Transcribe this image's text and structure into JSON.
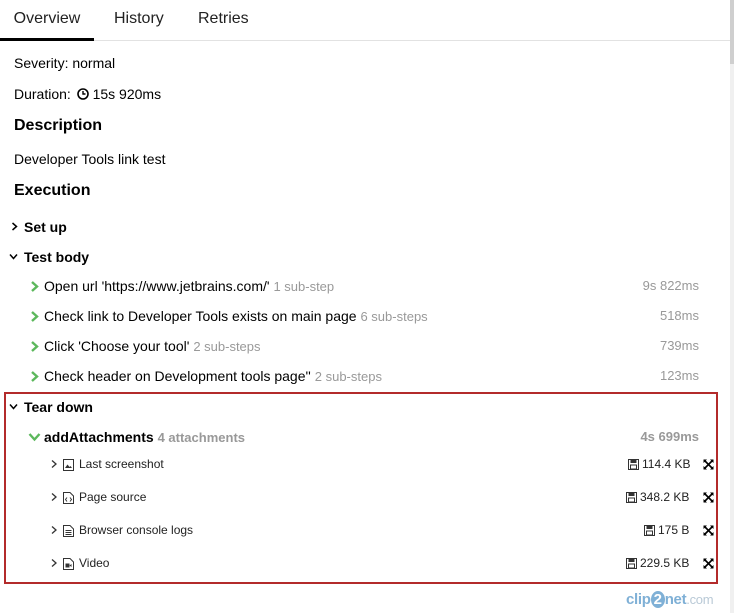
{
  "tabs": [
    "Overview",
    "History",
    "Retries"
  ],
  "severity": "Severity: normal",
  "duration_label": "Duration:",
  "duration_value": "15s 920ms",
  "description_heading": "Description",
  "description_text": "Developer Tools link test",
  "execution_heading": "Execution",
  "setup_label": "Set up",
  "test_body_label": "Test body",
  "steps": [
    {
      "name": "Open url 'https://www.jetbrains.com/'",
      "sub": "1 sub-step",
      "time": "9s 822ms"
    },
    {
      "name": "Check link to Developer Tools exists on main page",
      "sub": "6 sub-steps",
      "time": "518ms"
    },
    {
      "name": "Click 'Choose your tool'",
      "sub": "2 sub-steps",
      "time": "739ms"
    },
    {
      "name": "Check header on Development tools page''",
      "sub": "2 sub-steps",
      "time": "123ms"
    }
  ],
  "teardown_label": "Tear down",
  "add_attachments": {
    "name": "addAttachments",
    "count": "4 attachments",
    "time": "4s 699ms"
  },
  "attachments": [
    {
      "name": "Last screenshot",
      "size": "114.4 KB",
      "icon": "image-file-icon"
    },
    {
      "name": "Page source",
      "size": "348.2 KB",
      "icon": "code-file-icon"
    },
    {
      "name": "Browser console logs",
      "size": "175 B",
      "icon": "text-file-icon"
    },
    {
      "name": "Video",
      "size": "229.5 KB",
      "icon": "video-file-icon"
    }
  ],
  "watermark": {
    "a": "clip",
    "b": "2",
    "c": "net",
    "d": ".com"
  },
  "colors": {
    "accent_green": "#5cb85c",
    "highlight_red": "#b32b2b",
    "muted": "#999999"
  }
}
